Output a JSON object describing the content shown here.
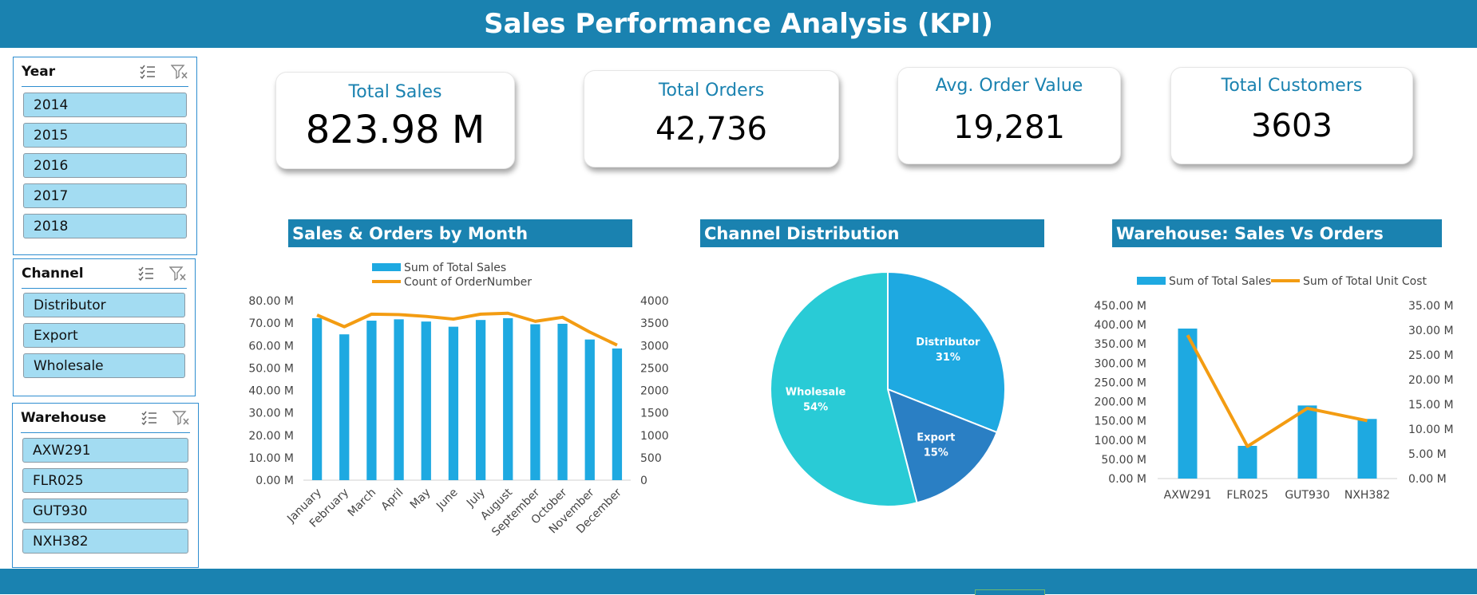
{
  "header": {
    "title": "Sales Performance Analysis (KPI)"
  },
  "slicers": {
    "year": {
      "title": "Year",
      "items": [
        "2014",
        "2015",
        "2016",
        "2017",
        "2018"
      ]
    },
    "channel": {
      "title": "Channel",
      "items": [
        "Distributor",
        "Export",
        "Wholesale"
      ]
    },
    "warehouse": {
      "title": "Warehouse",
      "items": [
        "AXW291",
        "FLR025",
        "GUT930",
        "NXH382"
      ]
    }
  },
  "kpis": {
    "total_sales": {
      "label": "Total Sales",
      "value": "823.98 M"
    },
    "total_orders": {
      "label": "Total Orders",
      "value": "42,736"
    },
    "avg_order_value": {
      "label": "Avg. Order Value",
      "value": "19,281"
    },
    "total_customers": {
      "label": "Total Customers",
      "value": "3603"
    }
  },
  "colors": {
    "header": "#1a82b0",
    "bar": "#1ea9e1",
    "line": "#f39c12",
    "slicer_item": "#a3dcf2"
  },
  "chart_data": [
    {
      "type": "bar",
      "title": "Sales & Orders by Month",
      "categories": [
        "January",
        "February",
        "March",
        "April",
        "May",
        "June",
        "July",
        "August",
        "September",
        "October",
        "November",
        "December"
      ],
      "series": [
        {
          "name": "Sum of Total Sales",
          "type": "bar",
          "axis": "left",
          "values": [
            72.2,
            65.0,
            71.1,
            71.7,
            70.7,
            68.4,
            71.4,
            72.2,
            69.5,
            69.7,
            62.7,
            58.7
          ]
        },
        {
          "name": "Count of OrderNumber",
          "type": "line",
          "axis": "right",
          "values": [
            3680,
            3420,
            3700,
            3690,
            3650,
            3590,
            3700,
            3720,
            3540,
            3630,
            3300,
            3010
          ]
        }
      ],
      "y_left": {
        "min": 0,
        "max": 80,
        "ticks": [
          "0.00 M",
          "10.00 M",
          "20.00 M",
          "30.00 M",
          "40.00 M",
          "50.00 M",
          "60.00 M",
          "70.00 M",
          "80.00 M"
        ]
      },
      "y_right": {
        "min": 0,
        "max": 4000,
        "ticks": [
          "0",
          "500",
          "1000",
          "1500",
          "2000",
          "2500",
          "3000",
          "3500",
          "4000"
        ]
      },
      "legend": "top"
    },
    {
      "type": "pie",
      "title": "Channel Distribution",
      "slices": [
        {
          "name": "Distributor",
          "label": "31%",
          "value": 31,
          "color": "#1ea9e1"
        },
        {
          "name": "Export",
          "label": "15%",
          "value": 15,
          "color": "#2a7fc4"
        },
        {
          "name": "Wholesale",
          "label": "54%",
          "value": 54,
          "color": "#29cbd6"
        }
      ]
    },
    {
      "type": "bar",
      "title": "Warehouse: Sales Vs Orders",
      "categories": [
        "AXW291",
        "FLR025",
        "GUT930",
        "NXH382"
      ],
      "series": [
        {
          "name": "Sum of Total Sales",
          "type": "bar",
          "axis": "left",
          "values": [
            390,
            85,
            190,
            155
          ]
        },
        {
          "name": "Sum of Total Unit Cost",
          "type": "line",
          "axis": "right",
          "values": [
            29.0,
            6.5,
            14.2,
            11.7
          ]
        }
      ],
      "y_left": {
        "min": 0,
        "max": 450,
        "ticks": [
          "0.00 M",
          "50.00 M",
          "100.00 M",
          "150.00 M",
          "200.00 M",
          "250.00 M",
          "300.00 M",
          "350.00 M",
          "400.00 M",
          "450.00 M"
        ]
      },
      "y_right": {
        "min": 0,
        "max": 35,
        "ticks": [
          "0.00 M",
          "5.00 M",
          "10.00 M",
          "15.00 M",
          "20.00 M",
          "25.00 M",
          "30.00 M",
          "35.00 M"
        ]
      },
      "legend": "top"
    }
  ]
}
